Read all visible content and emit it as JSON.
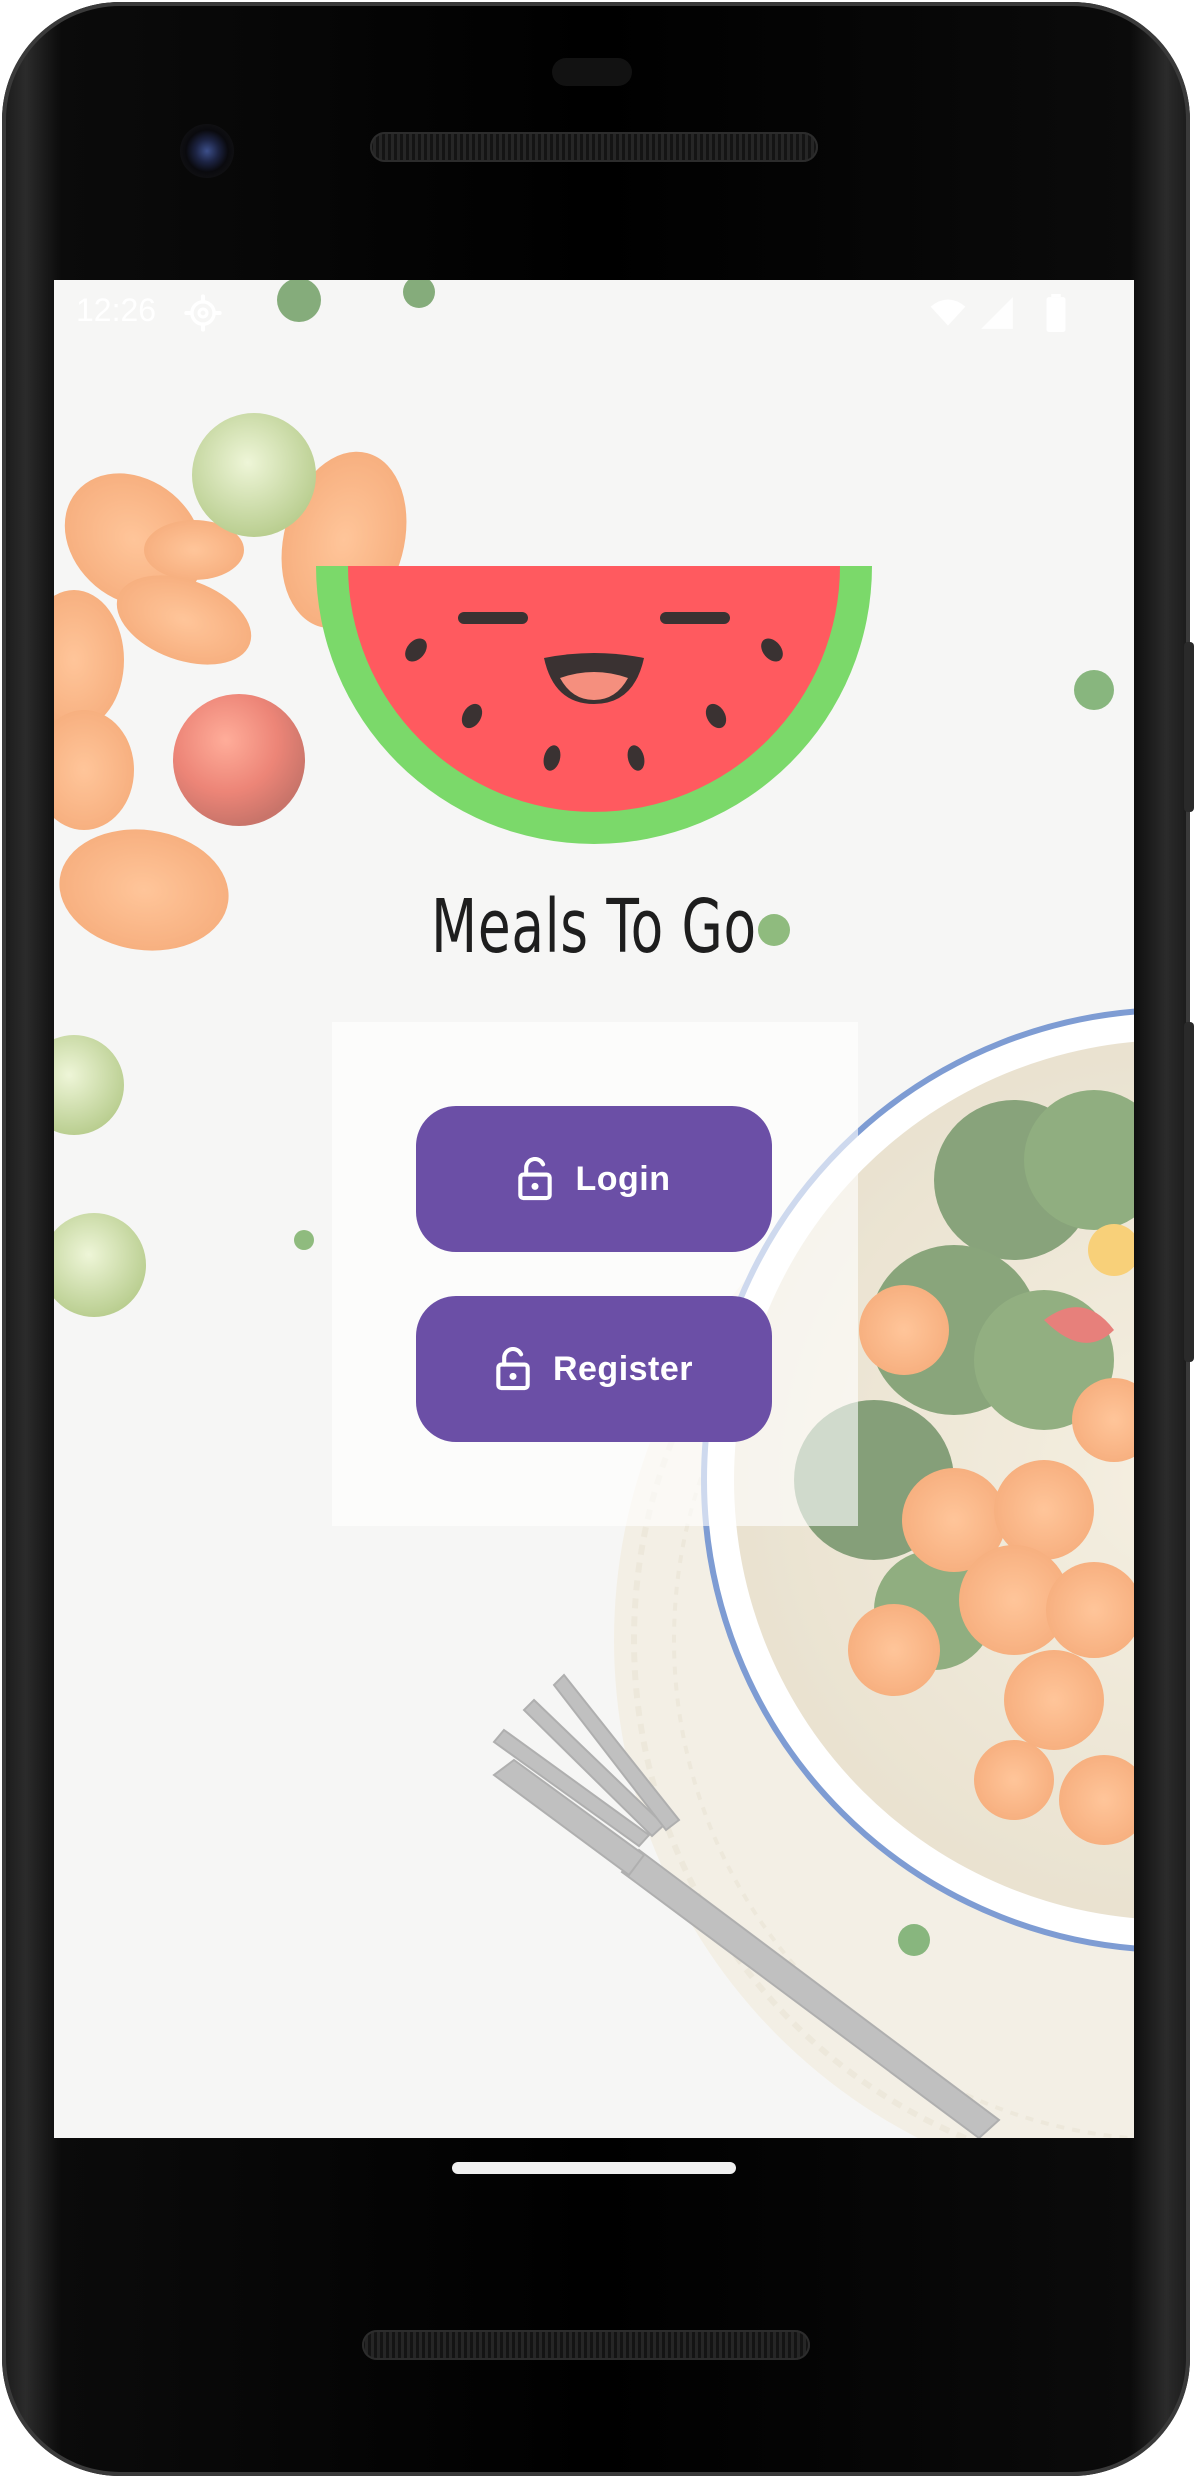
{
  "status_bar": {
    "time": "12:26",
    "icons": [
      "settings-icon",
      "wifi-icon",
      "signal-icon",
      "battery-icon"
    ]
  },
  "app": {
    "title": "Meals To Go",
    "logo": "watermelon-icon"
  },
  "buttons": {
    "login_label": "Login",
    "register_label": "Register"
  },
  "colors": {
    "button": "#6b4fa6",
    "watermelon_flesh": "#ff5a5f",
    "watermelon_rind": "#7bd96a"
  }
}
